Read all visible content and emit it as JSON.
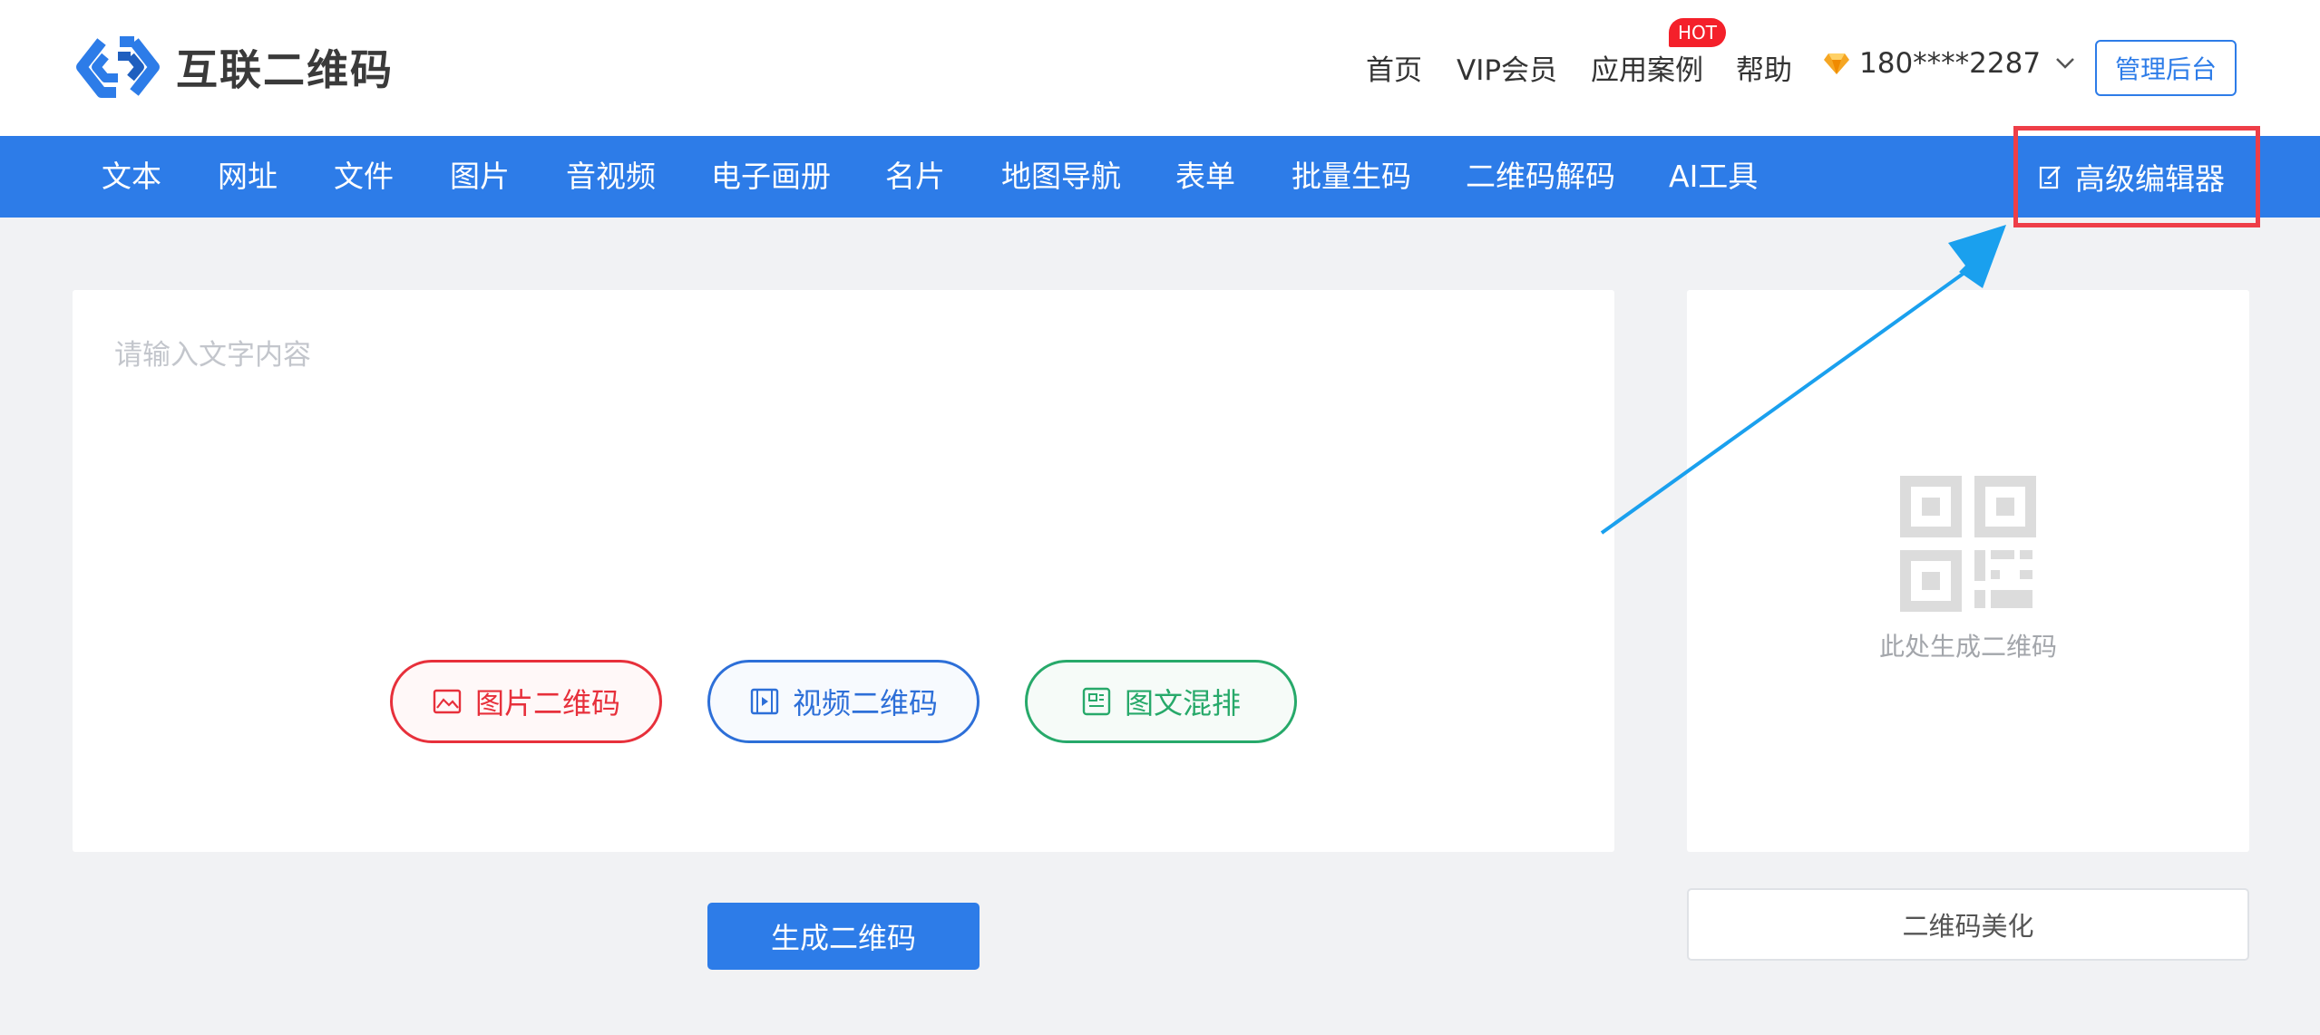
{
  "brand": {
    "name": "互联二维码"
  },
  "top_nav": {
    "items": [
      "首页",
      "VIP会员",
      "应用案例",
      "帮助"
    ],
    "hot_badge": "HOT",
    "user_phone": "180****2287",
    "admin_button": "管理后台"
  },
  "main_nav": {
    "items": [
      "文本",
      "网址",
      "文件",
      "图片",
      "音视频",
      "电子画册",
      "名片",
      "地图导航",
      "表单",
      "批量生码",
      "二维码解码",
      "AI工具"
    ],
    "advanced_editor": "高级编辑器"
  },
  "editor": {
    "placeholder": "请输入文字内容",
    "image_qr_button": "图片二维码",
    "video_qr_button": "视频二维码",
    "mixed_button": "图文混排",
    "generate_button": "生成二维码"
  },
  "preview": {
    "caption": "此处生成二维码",
    "beautify_button": "二维码美化"
  },
  "colors": {
    "primary": "#2d7ce8",
    "highlight": "#ee3e48",
    "arrow": "#1aa0ee",
    "red": "#e7303b",
    "blue": "#2d6fd8",
    "green": "#27a96a"
  }
}
